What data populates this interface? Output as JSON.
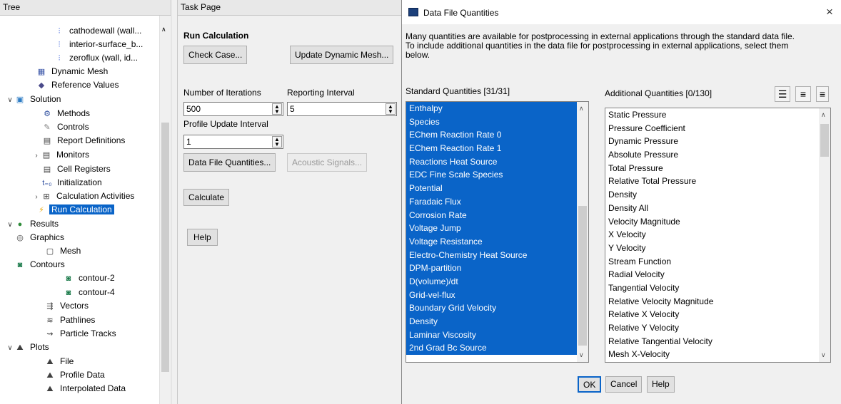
{
  "tree": {
    "header": "Tree",
    "items": [
      {
        "label": "cathodewall (wall...",
        "icon": "boundary-icon",
        "glyph": "⫶",
        "color": "#2a55d6",
        "arrow": ""
      },
      {
        "label": "interior-surface_b...",
        "icon": "boundary-icon",
        "glyph": "⫶",
        "color": "#2a55d6",
        "arrow": ""
      },
      {
        "label": "zeroflux (wall, id...",
        "icon": "boundary-icon",
        "glyph": "⫶",
        "color": "#2a55d6",
        "arrow": ""
      },
      {
        "label": "Dynamic Mesh",
        "icon": "dynamic-mesh-icon",
        "glyph": "▦",
        "color": "#3a55a8",
        "arrow": ""
      },
      {
        "label": "Reference Values",
        "icon": "reference-values-icon",
        "glyph": "◆",
        "color": "#4a4a8a",
        "arrow": ""
      },
      {
        "label": "Solution",
        "icon": "solution-icon",
        "glyph": "▣",
        "color": "#2d7cc4",
        "arrow": "∨"
      },
      {
        "label": "Methods",
        "icon": "methods-icon",
        "glyph": "⚙",
        "color": "#3050a0",
        "arrow": ""
      },
      {
        "label": "Controls",
        "icon": "controls-icon",
        "glyph": "✎",
        "color": "#808080",
        "arrow": ""
      },
      {
        "label": "Report Definitions",
        "icon": "report-definitions-icon",
        "glyph": "▤",
        "color": "#404040",
        "arrow": ""
      },
      {
        "label": "Monitors",
        "icon": "monitors-icon",
        "glyph": "▤",
        "color": "#404040",
        "arrow": "›"
      },
      {
        "label": "Cell Registers",
        "icon": "cell-registers-icon",
        "glyph": "▤",
        "color": "#404040",
        "arrow": ""
      },
      {
        "label": "Initialization",
        "icon": "initialization-icon",
        "glyph": "t₌₀",
        "color": "#3050a0",
        "arrow": ""
      },
      {
        "label": "Calculation Activities",
        "icon": "calculation-activities-icon",
        "glyph": "⊞",
        "color": "#404040",
        "arrow": "›"
      },
      {
        "label": "Run Calculation",
        "icon": "run-calculation-icon",
        "glyph": "⚡",
        "color": "#e8a400",
        "arrow": ""
      },
      {
        "label": "Results",
        "icon": "results-icon",
        "glyph": "●",
        "color": "#2f8c3a",
        "arrow": "∨"
      },
      {
        "label": "Graphics",
        "icon": "graphics-icon",
        "glyph": "◎",
        "color": "#404040",
        "arrow": "∨"
      },
      {
        "label": "Mesh",
        "icon": "mesh-icon",
        "glyph": "▢",
        "color": "#404040",
        "arrow": ""
      },
      {
        "label": "Contours",
        "icon": "contours-icon",
        "glyph": "◙",
        "color": "#1a7a4a",
        "arrow": "∨"
      },
      {
        "label": "contour-2",
        "icon": "contour-icon",
        "glyph": "◙",
        "color": "#1a7a4a",
        "arrow": ""
      },
      {
        "label": "contour-4",
        "icon": "contour-icon",
        "glyph": "◙",
        "color": "#1a7a4a",
        "arrow": ""
      },
      {
        "label": "Vectors",
        "icon": "vectors-icon",
        "glyph": "⇶",
        "color": "#404040",
        "arrow": ""
      },
      {
        "label": "Pathlines",
        "icon": "pathlines-icon",
        "glyph": "≋",
        "color": "#404040",
        "arrow": ""
      },
      {
        "label": "Particle Tracks",
        "icon": "particle-tracks-icon",
        "glyph": "⇝",
        "color": "#404040",
        "arrow": ""
      },
      {
        "label": "Plots",
        "icon": "plots-icon",
        "glyph": "⛰",
        "color": "#404040",
        "arrow": "∨"
      },
      {
        "label": "File",
        "icon": "plot-file-icon",
        "glyph": "⛰",
        "color": "#404040",
        "arrow": ""
      },
      {
        "label": "Profile Data",
        "icon": "profile-data-icon",
        "glyph": "⛰",
        "color": "#404040",
        "arrow": ""
      },
      {
        "label": "Interpolated Data",
        "icon": "interpolated-data-icon",
        "glyph": "⛰",
        "color": "#404040",
        "arrow": ""
      }
    ]
  },
  "task_page": {
    "header": "Task Page",
    "title": "Run Calculation",
    "check_case_label": "Check Case...",
    "update_dynamic_mesh_label": "Update Dynamic Mesh...",
    "number_of_iterations_label": "Number of Iterations",
    "number_of_iterations_value": "500",
    "reporting_interval_label": "Reporting Interval",
    "reporting_interval_value": "5",
    "profile_update_interval_label": "Profile Update Interval",
    "profile_update_interval_value": "1",
    "data_file_quantities_label": "Data File Quantities...",
    "acoustic_signals_label": "Acoustic Signals...",
    "calculate_label": "Calculate",
    "help_label": "Help"
  },
  "dialog": {
    "title": "Data File Quantities",
    "close_glyph": "×",
    "description": "Many quantities are available for postprocessing in external applications through the standard data file. To include additional quantities in the data file for postprocessing in external applications, select them below.",
    "standard_title": "Standard Quantities [31/31]",
    "standard_items": [
      "Enthalpy",
      "Species",
      "EChem Reaction Rate 0",
      "EChem Reaction Rate 1",
      "Reactions Heat Source",
      "EDC Fine Scale Species",
      "Potential",
      "Faradaic Flux",
      "Corrosion Rate",
      "Voltage Jump",
      "Voltage Resistance",
      "Electro-Chemistry Heat Source",
      "DPM-partition",
      "D(volume)/dt",
      "Grid-vel-flux",
      "Boundary Grid Velocity",
      "Density",
      "Laminar Viscosity",
      "2nd Grad Bc Source"
    ],
    "additional_title": "Additional Quantities [0/130]",
    "additional_items": [
      "Static Pressure",
      "Pressure Coefficient",
      "Dynamic Pressure",
      "Absolute Pressure",
      "Total Pressure",
      "Relative Total Pressure",
      "Density",
      "Density All",
      "Velocity Magnitude",
      "X Velocity",
      "Y Velocity",
      "Stream Function",
      "Radial Velocity",
      "Tangential Velocity",
      "Relative Velocity Magnitude",
      "Relative X Velocity",
      "Relative Y Velocity",
      "Relative Tangential Velocity",
      "Mesh X-Velocity"
    ],
    "ok_label": "OK",
    "cancel_label": "Cancel",
    "help_label": "Help"
  }
}
